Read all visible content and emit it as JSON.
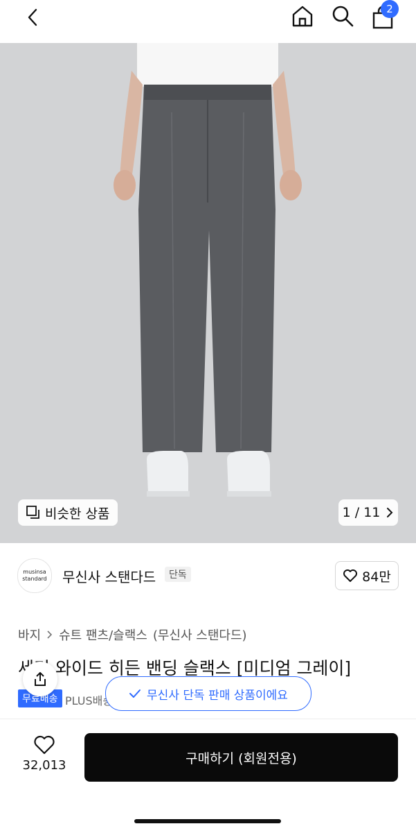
{
  "header": {
    "cart_count": "2"
  },
  "hero": {
    "similar_label": "비슷한 상품",
    "counter": "1 / 11"
  },
  "brand": {
    "logo_line1": "musinsa",
    "logo_line2": "standard",
    "name": "무신사 스탠다드",
    "exclusive": "단독",
    "likes": "84만"
  },
  "product": {
    "breadcrumb": [
      "바지",
      "슈트 팬츠/슬랙스",
      "(무신사 스탠다드)"
    ],
    "title": "세미 와이드 히든 밴딩 슬랙스 [미디엄 그레이]",
    "tag_blue": "무료배송",
    "tag_gray": "PLUS배송"
  },
  "toast": {
    "text": "무신사 단독 판매 상품이에요"
  },
  "bottom": {
    "wish_count": "32,013",
    "buy_label": "구매하기 (회원전용)"
  },
  "colors": {
    "accent": "#2f6bff",
    "hero_bg": "#d2d3d5",
    "buy_bg": "#0a0a0a"
  }
}
